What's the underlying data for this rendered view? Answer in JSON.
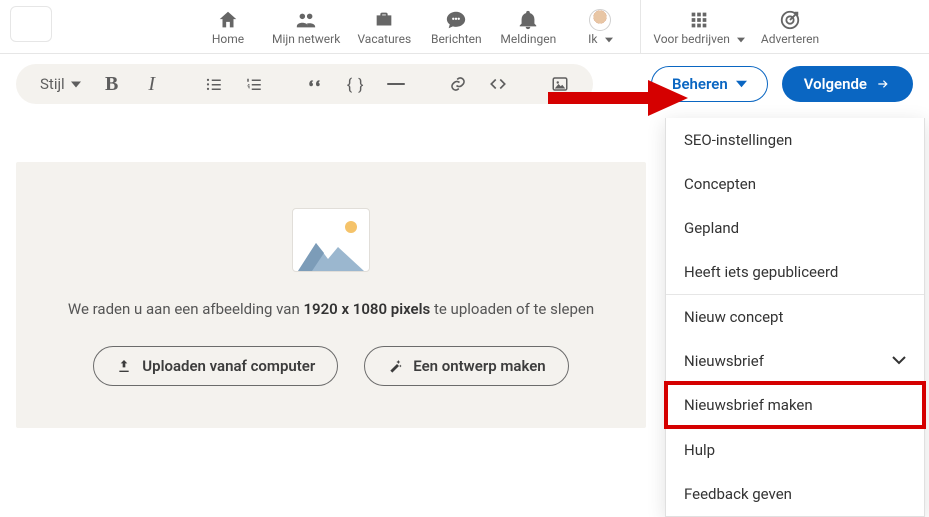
{
  "nav": {
    "items": [
      {
        "key": "home",
        "label": "Home"
      },
      {
        "key": "network",
        "label": "Mijn netwerk"
      },
      {
        "key": "jobs",
        "label": "Vacatures"
      },
      {
        "key": "msg",
        "label": "Berichten"
      },
      {
        "key": "notif",
        "label": "Meldingen"
      },
      {
        "key": "me",
        "label": "Ik"
      }
    ],
    "right": [
      {
        "key": "biz",
        "label": "Voor bedrijven"
      },
      {
        "key": "adv",
        "label": "Adverteren"
      }
    ]
  },
  "toolbar": {
    "style_label": "Stijl",
    "manage_label": "Beheren",
    "next_label": "Volgende"
  },
  "canvas": {
    "hint_pre": "We raden u aan een afbeelding van ",
    "hint_bold": "1920 x 1080 pixels",
    "hint_post": " te uploaden of te slepen",
    "upload_label": "Uploaden vanaf computer",
    "design_label": "Een ontwerp maken"
  },
  "menu": {
    "items": [
      "SEO-instellingen",
      "Concepten",
      "Gepland",
      "Heeft iets gepubliceerd",
      "Nieuw concept",
      "Nieuwsbrief",
      "Nieuwsbrief maken",
      "Hulp",
      "Feedback geven"
    ],
    "expandable_index": 5,
    "highlight_index": 6
  }
}
